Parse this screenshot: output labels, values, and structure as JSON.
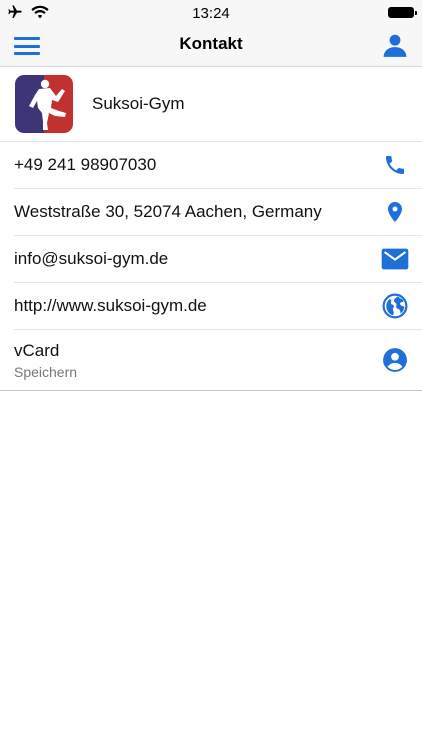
{
  "status_bar": {
    "time": "13:24",
    "icons": [
      "airplane-icon",
      "wifi-icon",
      "battery-icon"
    ]
  },
  "nav": {
    "title": "Kontakt",
    "left_icon": "menu-icon",
    "right_icon": "user-icon"
  },
  "header": {
    "name": "Suksoi-Gym",
    "logo_colors": [
      "#3d3576",
      "#c0312f"
    ]
  },
  "rows": [
    {
      "label": "+49 241 98907030",
      "icon": "phone-icon"
    },
    {
      "label": "Weststraße 30, 52074 Aachen, Germany",
      "icon": "location-pin-icon"
    },
    {
      "label": "info@suksoi-gym.de",
      "icon": "mail-icon"
    },
    {
      "label": "http://www.suksoi-gym.de",
      "icon": "globe-icon"
    },
    {
      "label": "vCard",
      "sublabel": "Speichern",
      "icon": "account-circle-icon"
    }
  ],
  "colors": {
    "accent": "#1e6fd9",
    "bar_background": "#f7f7f7"
  }
}
